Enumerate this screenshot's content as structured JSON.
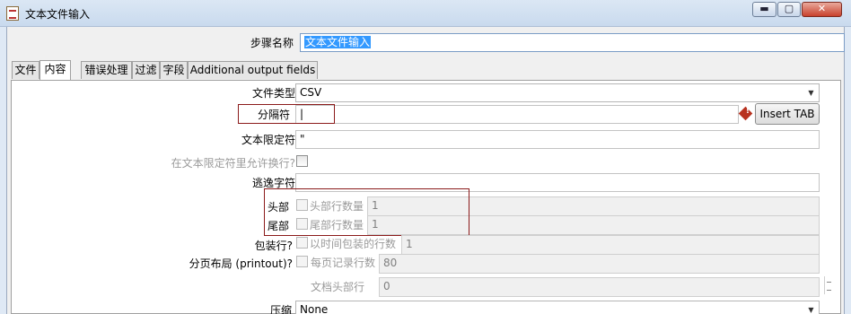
{
  "window": {
    "title": "文本文件输入",
    "min_glyph": "▬",
    "max_glyph": "▢",
    "close_glyph": "✕"
  },
  "step_name": {
    "label": "步骤名称",
    "value": "文本文件输入"
  },
  "tabs": [
    {
      "label": "文件",
      "active": false
    },
    {
      "label": "内容",
      "active": true
    },
    {
      "label": "错误处理",
      "active": false
    },
    {
      "label": "过滤",
      "active": false
    },
    {
      "label": "字段",
      "active": false
    },
    {
      "label": "Additional output fields",
      "active": false
    }
  ],
  "form": {
    "file_type": {
      "label": "文件类型",
      "value": "CSV"
    },
    "separator": {
      "label": "分隔符",
      "value": "|",
      "insert_tab_label": "Insert TAB",
      "warning_glyph": "!"
    },
    "enclosure": {
      "label": "文本限定符",
      "value": "\""
    },
    "allow_breaks": {
      "label": "在文本限定符里允许换行?"
    },
    "escape": {
      "label": "逃逸字符",
      "value": ""
    },
    "header": {
      "label": "头部",
      "count_label": "头部行数量",
      "count_value": "1"
    },
    "footer": {
      "label": "尾部",
      "count_label": "尾部行数量",
      "count_value": "1"
    },
    "wrap": {
      "label": "包装行?",
      "count_label": "以时间包装的行数",
      "count_value": "1"
    },
    "paged": {
      "label": "分页布局 (printout)?",
      "rows_label": "每页记录行数",
      "rows_value": "80",
      "doc_header_label": "文档头部行",
      "doc_header_value": "0"
    },
    "compression": {
      "label": "压缩",
      "value": "None"
    }
  }
}
